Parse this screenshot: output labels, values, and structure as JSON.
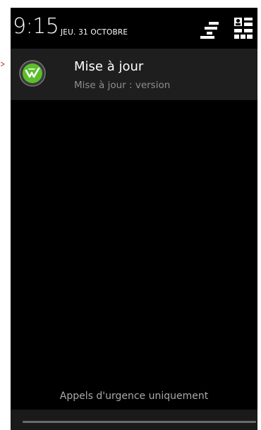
{
  "status": {
    "time": "9:15",
    "date": "JEU. 31 OCTOBRE",
    "icons": [
      "settings-toggle-icon",
      "quick-settings-icon"
    ]
  },
  "notification": {
    "title": "Mise à jour",
    "text": "Mise à jour : version",
    "icon": "update-app-icon",
    "icon_color": "#5bbf2a"
  },
  "footer": {
    "emergency_label": "Appels d'urgence uniquement"
  },
  "colors": {
    "background": "#000000",
    "notification_bg": "#1e1e1e",
    "secondary_text": "#8e8e8e",
    "accent": "#5bbf2a"
  }
}
